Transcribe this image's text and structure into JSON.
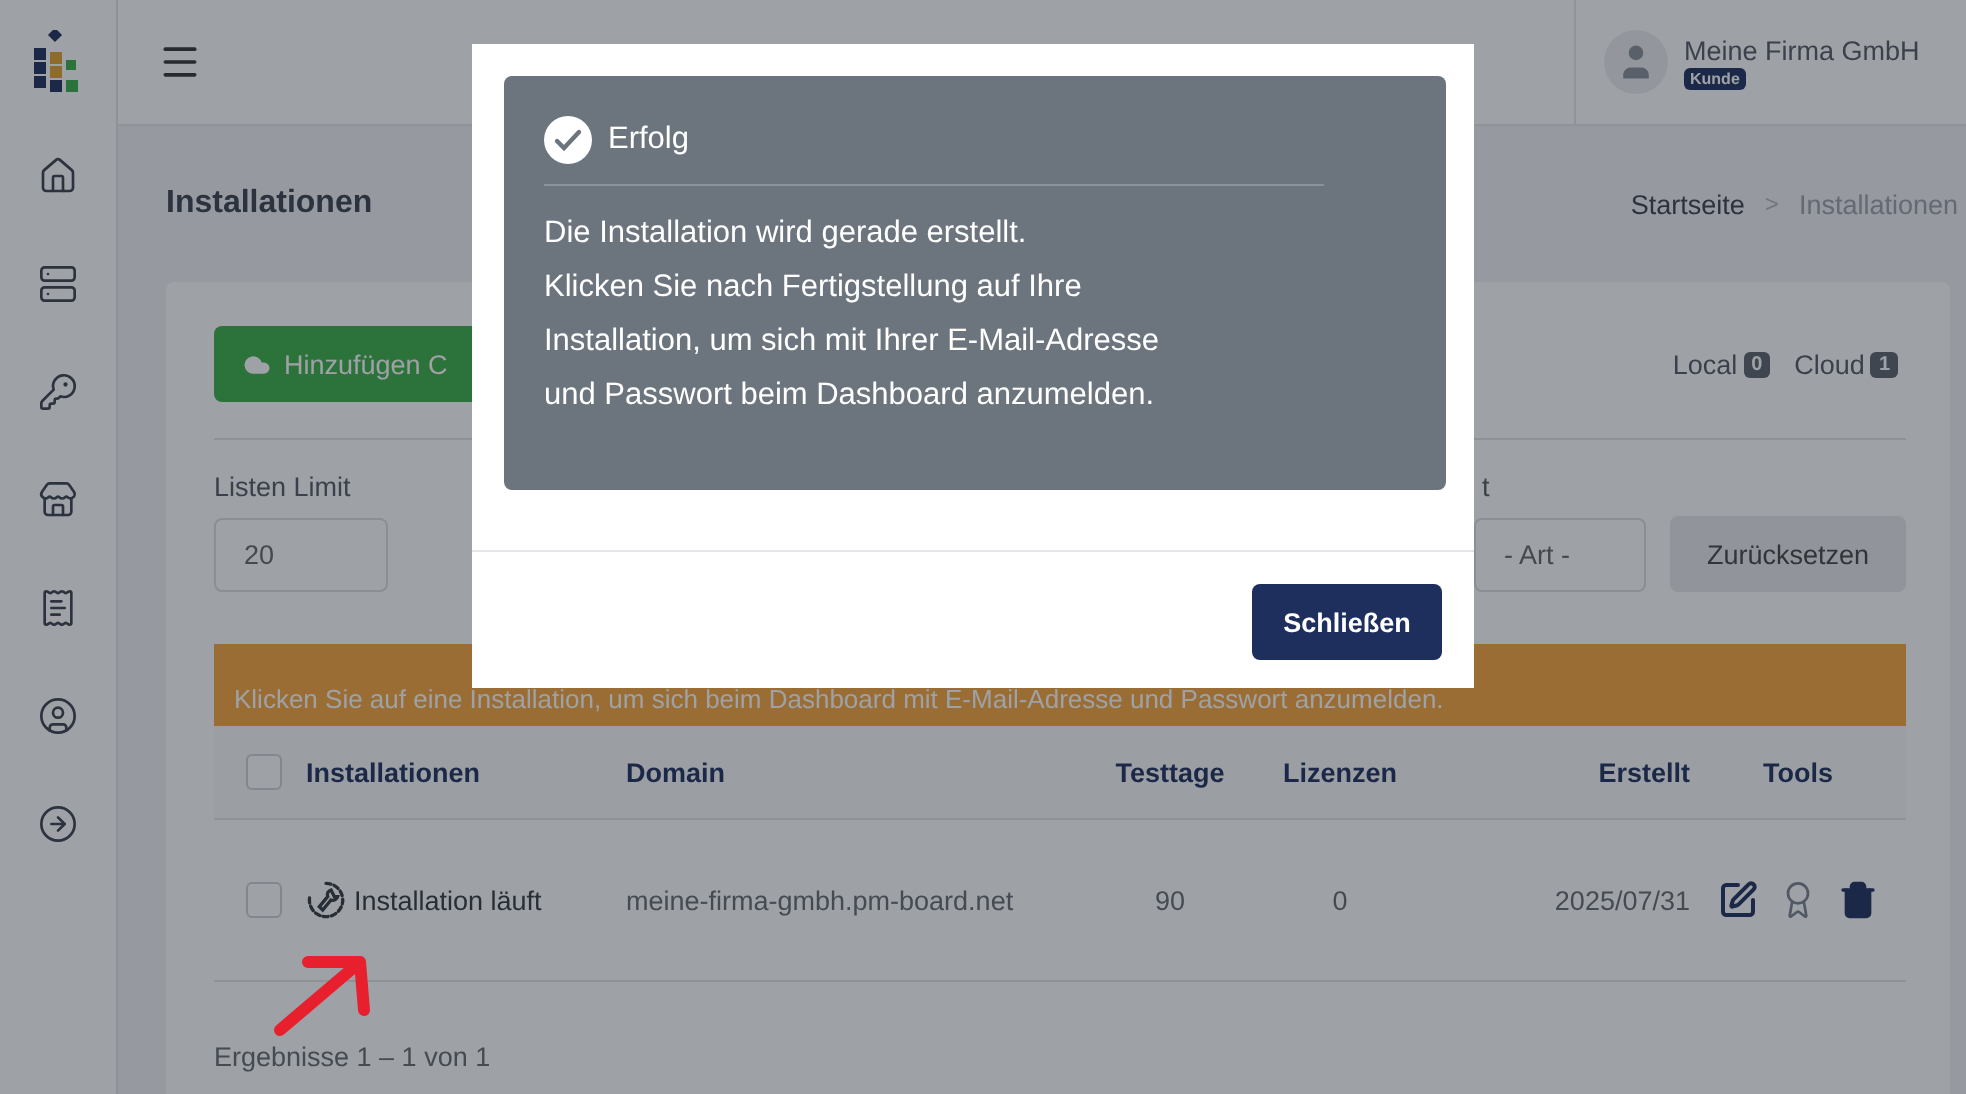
{
  "header": {
    "user_name": "Meine Firma GmbH",
    "user_role": "Kunde"
  },
  "page": {
    "title": "Installationen",
    "breadcrumb_separator": ">",
    "breadcrumb": [
      {
        "label": "Startseite",
        "current": false
      },
      {
        "label": "Installationen",
        "current": true
      }
    ]
  },
  "toolbar": {
    "add_button": "Hinzufügen C",
    "counters": [
      {
        "label": "Local",
        "count": "0"
      },
      {
        "label": "Cloud",
        "count": "1"
      }
    ]
  },
  "filters": {
    "limit_label": "Listen Limit",
    "limit_value": "20",
    "type_label": "t",
    "type_value": "- Art -",
    "reset_button": "Zurücksetzen"
  },
  "notice": "Klicken Sie auf eine Installation, um sich beim Dashboard mit E-Mail-Adresse und Passwort anzumelden.",
  "table": {
    "header_checked": false,
    "columns": [
      "Installationen",
      "Domain",
      "Testtage",
      "Lizenzen",
      "Erstellt",
      "Tools"
    ],
    "rows": [
      {
        "checked": false,
        "status": "Installation läuft",
        "domain": "meine-firma-gmbh.pm-board.net",
        "trial_days": "90",
        "licenses": "0",
        "created": "2025/07/31"
      }
    ]
  },
  "results": "Ergebnisse 1 – 1 von 1",
  "modal": {
    "title": "Erfolg",
    "message": "Die Installation wird gerade erstellt.\nKlicken Sie nach Fertigstellung auf Ihre\nInstallation, um sich mit Ihrer E-Mail-Adresse\nund Passwort beim Dashboard anzumelden.",
    "close_button": "Schließen"
  }
}
